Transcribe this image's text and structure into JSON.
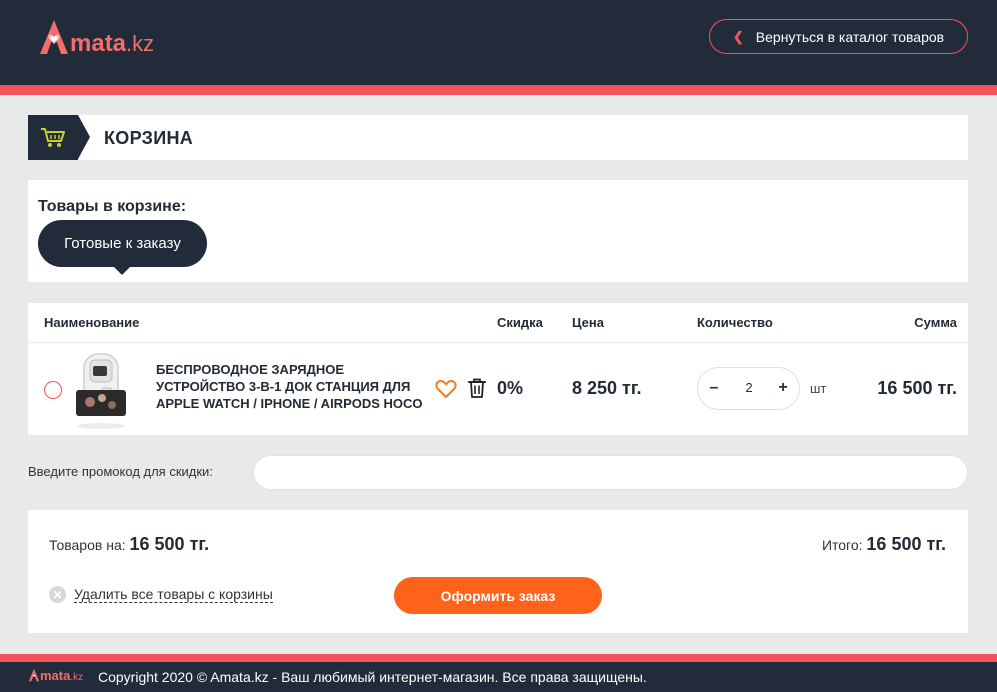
{
  "header": {
    "logo_main": "mata",
    "logo_suffix": ".kz",
    "back_label": "Вернуться в каталог товаров"
  },
  "page": {
    "title": "КОРЗИНА"
  },
  "items_section": {
    "heading": "Товары в корзине:",
    "tab_ready": "Готовые к заказу"
  },
  "table": {
    "columns": {
      "name": "Наименование",
      "discount": "Скидка",
      "price": "Цена",
      "quantity": "Количество",
      "sum": "Сумма"
    },
    "rows": [
      {
        "name": "БЕСПРОВОДНОЕ ЗАРЯДНОЕ УСТРОЙСТВО 3-В-1 ДОК СТАНЦИЯ ДЛЯ APPLE WATCH / IPHONE / AIRPODS HOCO",
        "discount": "0%",
        "price": "8 250 тг.",
        "quantity": "2",
        "unit": "шт",
        "minus": "–",
        "plus": "+",
        "sum": "16 500 тг."
      }
    ]
  },
  "promo": {
    "label": "Введите промокод для скидки:",
    "value": ""
  },
  "summary": {
    "goods_label": "Товаров на:",
    "goods_value": "16 500 тг.",
    "total_label": "Итого:",
    "total_value": "16 500 тг.",
    "clear_label": "Удалить все товары с корзины",
    "order_button": "Оформить заказ"
  },
  "footer": {
    "logo_main": "mata",
    "logo_suffix": ".kz",
    "copyright": "Copyright 2020 © Amata.kz -  Ваш любимый интернет-магазин. Все права защищены."
  },
  "colors": {
    "dark": "#222b3a",
    "accent": "#f2545b",
    "order": "#ff6319",
    "background": "#e8eaea"
  },
  "icons": [
    "amata-logo-icon",
    "chevron-left-icon",
    "cart-icon",
    "radio-icon",
    "product-thumbnail",
    "heart-icon",
    "trash-icon",
    "close-circle-icon"
  ]
}
